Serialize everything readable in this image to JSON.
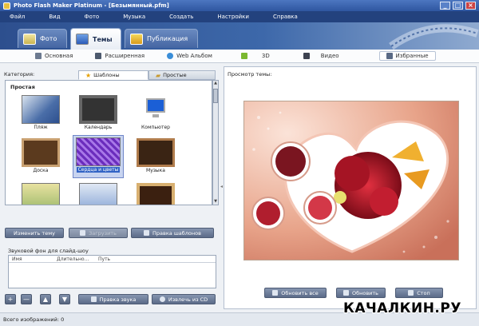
{
  "window": {
    "title": "Photo Flash Maker Platinum - [Безымянный.pfm]",
    "controls": [
      "_",
      "□",
      "×"
    ]
  },
  "menu": [
    "Файл",
    "Вид",
    "Фото",
    "Музыка",
    "Создать",
    "Настройки",
    "Справка"
  ],
  "main_tabs": [
    {
      "label": "Фото",
      "icon": "photo-icon",
      "active": false
    },
    {
      "label": "Темы",
      "icon": "themes-icon",
      "active": true
    },
    {
      "label": "Публикация",
      "icon": "publish-icon",
      "active": false
    }
  ],
  "sub_tabs": [
    {
      "label": "Основная",
      "icon": "basic-icon"
    },
    {
      "label": "Расширенная",
      "icon": "advanced-icon"
    },
    {
      "label": "Web Альбом",
      "icon": "web-album-icon"
    },
    {
      "label": "3D",
      "icon": "3d-icon"
    },
    {
      "label": "Видео",
      "icon": "video-icon"
    },
    {
      "label": "Избранные",
      "icon": "favorites-icon",
      "active": true
    }
  ],
  "left": {
    "category_label": "Категория:",
    "gallery_tabs": {
      "templates": "Шаблоны",
      "simple": "Простые"
    },
    "group_title": "Простая",
    "themes": [
      {
        "caption": "Пляж",
        "colors": [
          "#4a6ea8",
          "#d9e3ee"
        ]
      },
      {
        "caption": "Календарь",
        "colors": [
          "#333333",
          "#666666"
        ]
      },
      {
        "caption": "Компьютер",
        "colors": [
          "#ffffff",
          "#1b5fd6"
        ]
      },
      {
        "caption": "Доска",
        "colors": [
          "#5b3a1e",
          "#c8a070"
        ]
      },
      {
        "caption": "Сердца и цветы",
        "colors": [
          "#6b2dbd",
          "#a878e8"
        ],
        "selected": true
      },
      {
        "caption": "Музыка",
        "colors": [
          "#3a2414",
          "#b07c4c"
        ]
      },
      {
        "caption": "",
        "colors": [
          "#e8e2a0",
          "#9bb86a"
        ]
      },
      {
        "caption": "",
        "colors": [
          "#e0e8f4",
          "#89a7d6"
        ]
      },
      {
        "caption": "",
        "colors": [
          "#3b2010",
          "#d8b070"
        ]
      }
    ],
    "buttons": {
      "change_theme": "Изменить тему",
      "load": "Загрузить",
      "edit_templates": "Правка шаблонов"
    }
  },
  "audio": {
    "label": "Звуковой фон для слайд-шоу",
    "columns": [
      "Имя",
      "Длительно...",
      "Путь"
    ],
    "buttons": {
      "add": "+",
      "remove": "—",
      "up": "▲",
      "down": "▼",
      "edit_sound": "Правка звука",
      "extract_cd": "Извлечь из CD"
    }
  },
  "preview": {
    "label": "Просмотр темы:",
    "buttons": {
      "refresh_all": "Обновить все",
      "refresh": "Обновить",
      "stop": "Стоп"
    }
  },
  "status": {
    "text": "Всего изображений: 0"
  },
  "watermark": "КАЧАЛКИН.РУ"
}
